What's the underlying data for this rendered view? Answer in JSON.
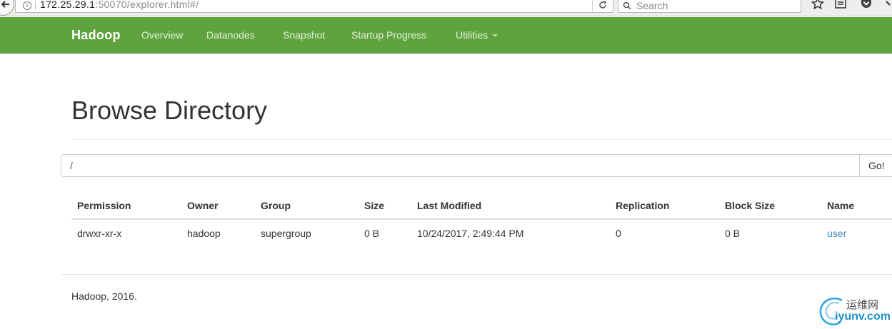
{
  "browser": {
    "url_host": "172.25.29.1",
    "url_rest": ":50070/explorer.html#/",
    "search_placeholder": "Search"
  },
  "navbar": {
    "brand": "Hadoop",
    "items": [
      {
        "label": "Overview"
      },
      {
        "label": "Datanodes"
      },
      {
        "label": "Snapshot"
      },
      {
        "label": "Startup Progress"
      },
      {
        "label": "Utilities"
      }
    ],
    "color": "#5fa33e"
  },
  "page": {
    "title": "Browse Directory",
    "path_value": "/",
    "go_label": "Go!"
  },
  "table": {
    "headers": [
      "Permission",
      "Owner",
      "Group",
      "Size",
      "Last Modified",
      "Replication",
      "Block Size",
      "Name"
    ],
    "rows": [
      {
        "permission": "drwxr-xr-x",
        "owner": "hadoop",
        "group": "supergroup",
        "size": "0 B",
        "last_modified": "10/24/2017, 2:49:44 PM",
        "replication": "0",
        "block_size": "0 B",
        "name": "user"
      }
    ],
    "link_color": "#3a87c8"
  },
  "footer": {
    "text": "Hadoop, 2016."
  },
  "watermark": {
    "cn": "运维网",
    "en": "iyunv.com"
  }
}
